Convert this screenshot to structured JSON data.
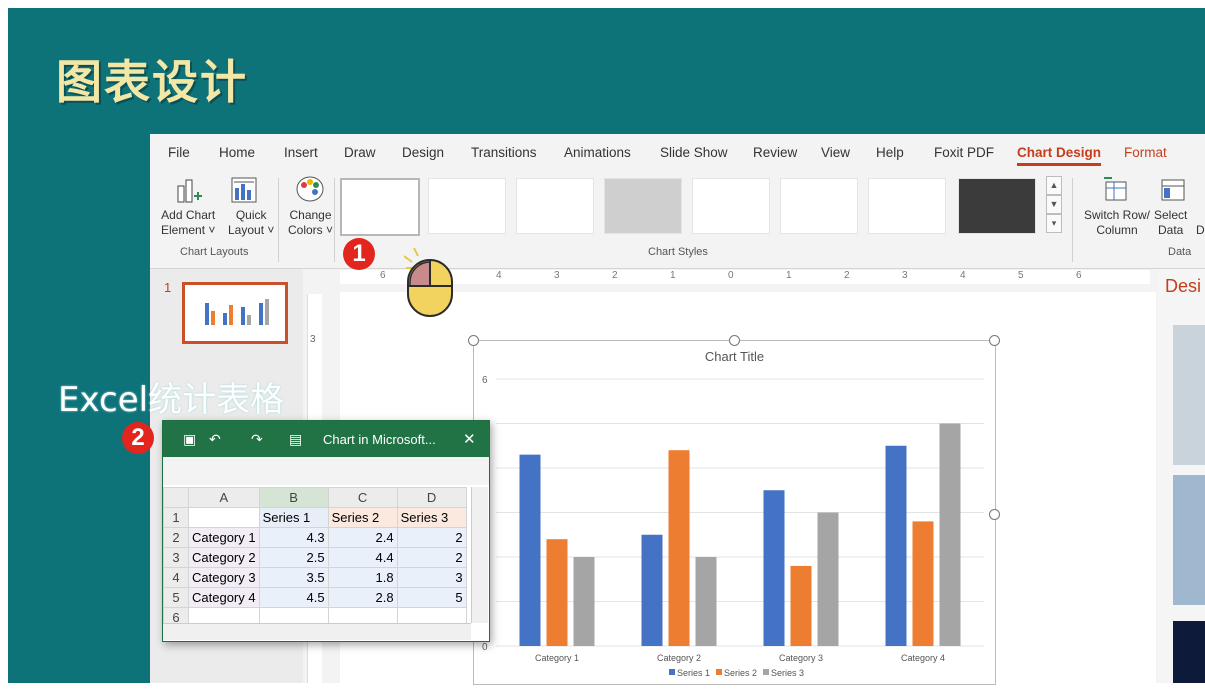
{
  "slide": {
    "title": "图表设计",
    "excel_label": "Excel统计表格",
    "badge1": "1",
    "badge2": "2"
  },
  "menu": {
    "items": [
      "File",
      "Home",
      "Insert",
      "Draw",
      "Design",
      "Transitions",
      "Animations",
      "Slide Show",
      "Review",
      "View",
      "Help",
      "Foxit PDF"
    ],
    "active": "Chart Design",
    "format": "Format"
  },
  "ribbon": {
    "add_chart_element": "Add Chart\nElement ˅",
    "quick_layout": "Quick\nLayout ˅",
    "change_colors": "Change\nColors ˅",
    "switch_row_column": "Switch Row/\nColumn",
    "select_data": "Select\nData",
    "edit_cut": "D",
    "group_chart_layouts": "Chart Layouts",
    "group_chart_styles": "Chart Styles",
    "group_data": "Data"
  },
  "slides_panel": {
    "number": "1"
  },
  "designer": {
    "label": "Desi"
  },
  "ruler": {
    "ticks": [
      "6",
      "5",
      "4",
      "3",
      "2",
      "1",
      "0",
      "1",
      "2",
      "3",
      "4",
      "5",
      "6"
    ],
    "vertical": "3"
  },
  "excel": {
    "title": "Chart in Microsoft...",
    "close": "✕",
    "columns": [
      "",
      "A",
      "B",
      "C",
      "D"
    ],
    "rows": [
      {
        "n": "1",
        "a": "",
        "b": "Series 1",
        "c": "Series 2",
        "d": "Series 3"
      },
      {
        "n": "2",
        "a": "Category 1",
        "b": "4.3",
        "c": "2.4",
        "d": "2"
      },
      {
        "n": "3",
        "a": "Category 2",
        "b": "2.5",
        "c": "4.4",
        "d": "2"
      },
      {
        "n": "4",
        "a": "Category 3",
        "b": "3.5",
        "c": "1.8",
        "d": "3"
      },
      {
        "n": "5",
        "a": "Category 4",
        "b": "4.5",
        "c": "2.8",
        "d": "5"
      },
      {
        "n": "6",
        "a": "",
        "b": "",
        "c": "",
        "d": ""
      }
    ]
  },
  "chart_data": {
    "type": "bar",
    "title": "Chart Title",
    "categories": [
      "Category 1",
      "Category 2",
      "Category 3",
      "Category 4"
    ],
    "series": [
      {
        "name": "Series 1",
        "values": [
          4.3,
          2.5,
          3.5,
          4.5
        ],
        "color": "#4472c4"
      },
      {
        "name": "Series 2",
        "values": [
          2.4,
          4.4,
          1.8,
          2.8
        ],
        "color": "#ed7d31"
      },
      {
        "name": "Series 3",
        "values": [
          2,
          2,
          3,
          5
        ],
        "color": "#a5a5a5"
      }
    ],
    "ylim": [
      0,
      6
    ],
    "yticks": [
      "0",
      "5",
      "6"
    ],
    "grid": true,
    "legend": "bottom"
  }
}
